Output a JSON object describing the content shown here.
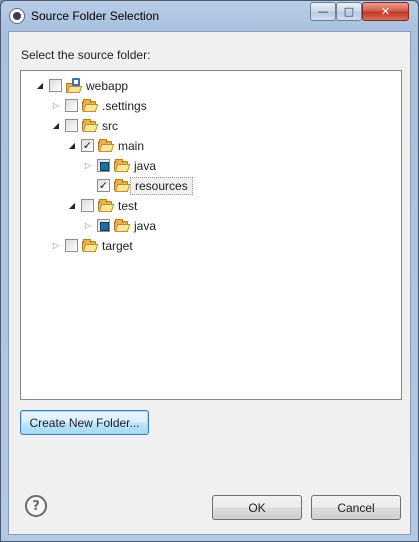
{
  "window": {
    "title": "Source Folder Selection",
    "minimize_glyph": "—",
    "maximize_glyph": "□",
    "close_glyph": "✕"
  },
  "dialog": {
    "prompt": "Select the source folder:",
    "help_glyph": "?",
    "create_folder_label": "Create New Folder...",
    "ok_label": "OK",
    "cancel_label": "Cancel"
  },
  "tree": {
    "items": [
      {
        "label": "webapp",
        "icon": "project-icon",
        "depth": 0,
        "expanded": true,
        "check": "unchecked"
      },
      {
        "label": ".settings",
        "icon": "folder-icon",
        "depth": 1,
        "expanded": false,
        "check": "unchecked"
      },
      {
        "label": "src",
        "icon": "folder-icon",
        "depth": 1,
        "expanded": true,
        "check": "unchecked"
      },
      {
        "label": "main",
        "icon": "folder-icon",
        "depth": 2,
        "expanded": true,
        "check": "checked"
      },
      {
        "label": "java",
        "icon": "folder-icon",
        "depth": 3,
        "expanded": false,
        "check": "partial"
      },
      {
        "label": "resources",
        "icon": "folder-icon",
        "depth": 3,
        "expanded": null,
        "check": "checked",
        "selected": true
      },
      {
        "label": "test",
        "icon": "folder-icon",
        "depth": 2,
        "expanded": true,
        "check": "unchecked"
      },
      {
        "label": "java",
        "icon": "folder-icon",
        "depth": 3,
        "expanded": false,
        "check": "partial"
      },
      {
        "label": "target",
        "icon": "folder-icon",
        "depth": 1,
        "expanded": false,
        "check": "unchecked"
      }
    ]
  },
  "glyphs": {
    "expanded": "◢",
    "collapsed": "▷",
    "check": "✓"
  }
}
